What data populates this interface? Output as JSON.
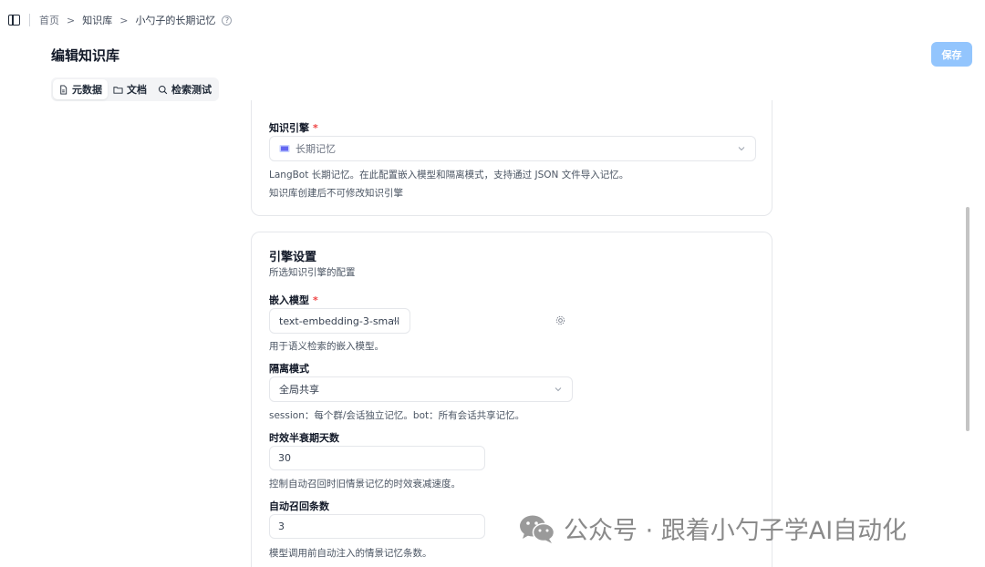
{
  "breadcrumb": {
    "items": [
      "首页",
      "知识库",
      "小勺子的长期记忆"
    ],
    "separator": ">",
    "help_icon": "?"
  },
  "page": {
    "title": "编辑知识库",
    "save_label": "保存"
  },
  "tabs": [
    {
      "label": "元数据",
      "icon": "document-icon",
      "active": true
    },
    {
      "label": "文档",
      "icon": "folder-icon",
      "active": false
    },
    {
      "label": "检索测试",
      "icon": "search-icon",
      "active": false
    }
  ],
  "engine_card": {
    "label": "知识引擎",
    "required_mark": "*",
    "selected": "长期记忆",
    "help_1": "LangBot 长期记忆。在此配置嵌入模型和隔离模式，支持通过 JSON 文件导入记忆。",
    "help_2": "知识库创建后不可修改知识引擎"
  },
  "settings_card": {
    "title": "引擎设置",
    "subtitle": "所选知识引擎的配置",
    "embedding": {
      "label": "嵌入模型",
      "required_mark": "*",
      "value": "text-embedding-3-small",
      "help": "用于语义检索的嵌入模型。"
    },
    "isolation": {
      "label": "隔离模式",
      "value": "全局共享",
      "help": "session：每个群/会话独立记忆。bot：所有会话共享记忆。"
    },
    "half_life": {
      "label": "时效半衰期天数",
      "value": "30",
      "help": "控制自动召回时旧情景记忆的时效衰减速度。"
    },
    "auto_recall": {
      "label": "自动召回条数",
      "value": "3",
      "help": "模型调用前自动注入的情景记忆条数。"
    }
  },
  "watermark": {
    "text": "公众号 · 跟着小勺子学AI自动化"
  },
  "colors": {
    "primary_disabled": "#93c5fd",
    "required": "#ef4444",
    "border": "#e5e7eb"
  }
}
